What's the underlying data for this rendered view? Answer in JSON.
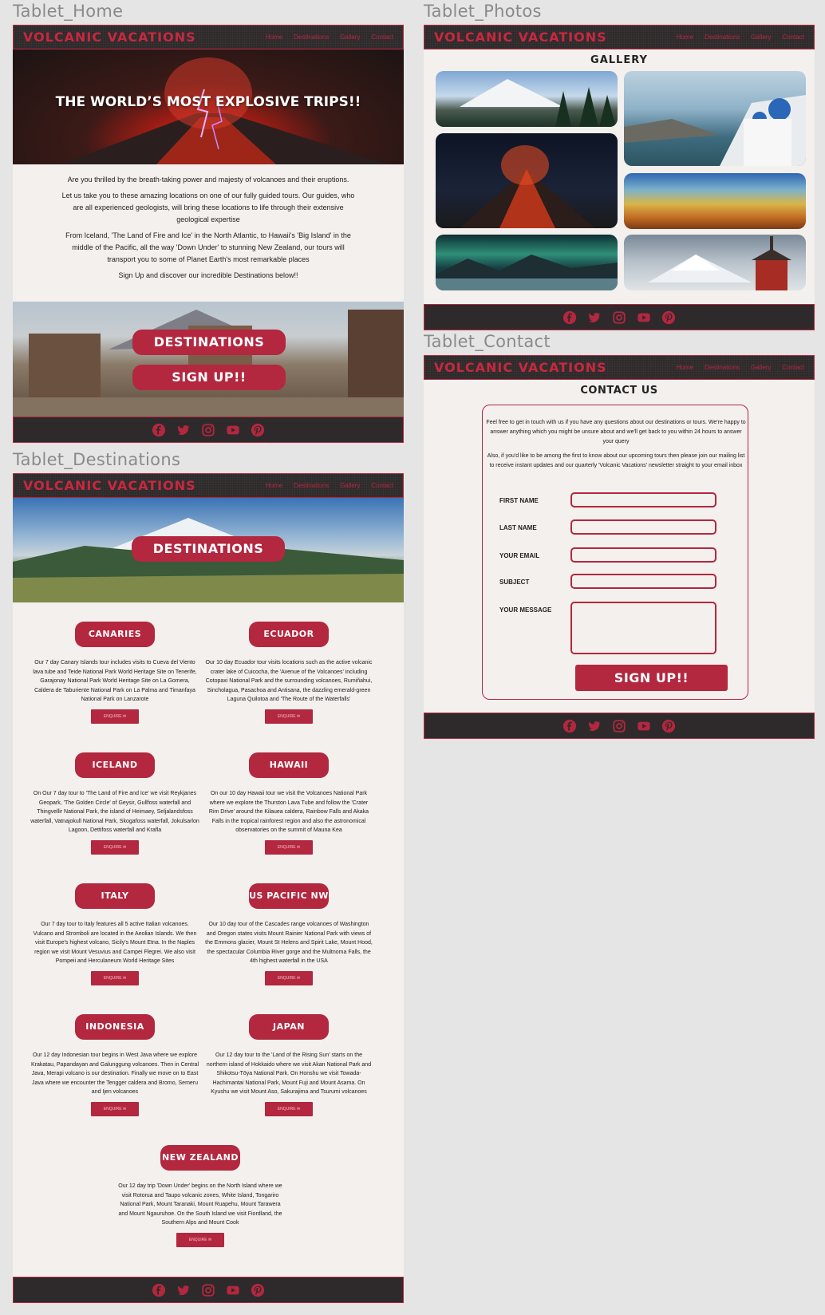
{
  "frames": {
    "home": "Tablet_Home",
    "photos": "Tablet_Photos",
    "contact": "Tablet_Contact",
    "destinations": "Tablet_Destinations"
  },
  "brand": "VOLCANIC VACATIONS",
  "nav": [
    "Home",
    "Destinations",
    "Gallery",
    "Contact"
  ],
  "social_icons": [
    "facebook-icon",
    "twitter-icon",
    "instagram-icon",
    "youtube-icon",
    "pinterest-icon"
  ],
  "colors": {
    "accent": "#b3273f",
    "dark": "#2e2a2b",
    "background": "#f3f0ee"
  },
  "home": {
    "hero_title": "THE WORLD’S MOST EXPLOSIVE TRIPS!!",
    "paragraphs": [
      "Are you thrilled by the breath-taking power and majesty of volcanoes and their eruptions.",
      "Let us take you to these amazing locations on one of our fully guided tours. Our guides, who are all experienced geologists, will bring these locations to life through their extensive geological expertise",
      "From Iceland, 'The Land of Fire and Ice' in the North Atlantic, to Hawaii's 'Big Island' in the middle of the Pacific, all the way 'Down Under'  to stunning New Zealand, our tours will transport you to some of Planet Earth's most remarkable places",
      "Sign Up and discover our incredible Destinations below!!"
    ],
    "destinations_button": "DESTINATIONS",
    "signup_button": "SIGN UP!!"
  },
  "photos": {
    "title": "GALLERY"
  },
  "contact": {
    "title": "CONTACT US",
    "intro1": "Feel free to get in touch with us if you have any questions about our destinations or tours. We're happy to answer anything which you might be unsure about and we'll get back to you within 24 hours to answer your query",
    "intro2": "Also, if you'd like to be among the first to know about our upcoming tours then please join our mailing list to receive instant updates and our quarterly 'Volcanic Vacations' newsletter straight to your email inbox",
    "labels": {
      "first": "FIRST NAME",
      "last": "LAST NAME",
      "email": "YOUR EMAIL",
      "subject": "SUBJECT",
      "message": "YOUR MESSAGE"
    },
    "submit": "SIGN UP!!"
  },
  "destinations": {
    "hero_button": "DESTINATIONS",
    "enquire": "ENQUIRE",
    "items": [
      {
        "name": "CANARIES",
        "text": "Our 7 day Canary Islands tour includes visits to Cueva del Viento lava tube and Teide National Park World Heritage Site on Tenerife, Garajonay National Park World Heritage Site on La Gomera, Caldera de Taburiente National Park on La Palma and Timanfaya National  Park on Lanzarote"
      },
      {
        "name": "ECUADOR",
        "text": "Our 10 day Ecuador tour visits locations such as the active volcanic crater lake of Cuicocha, the 'Avenue of the Volcanoes' including Cotopaxi National Park and the surrounding volcanoes, Rumiñahui, Sincholagua, Pasachoa and Antisana, the dazzling emerald-green Laguna Quilotoa and 'The Route of the Waterfalls'"
      },
      {
        "name": "ICELAND",
        "text": "On Our 7 day tour to 'The Land of Fire and Ice' we visit Reykjanes Geopark,  'The Golden Circle' of Geysir, Gullfoss waterfall and Thingvellir National Park, the island of Heimaey, Seljalandsfoss waterfall, Vatnajokull National Park, Skogafoss waterfall, Jokulsarlon Lagoon, Dettifoss waterfall and Krafla"
      },
      {
        "name": "HAWAII",
        "text": "On our 10 day Hawaii tour we visit the Volcanoes National Park where we explore the Thurston Lava Tube and follow the 'Crater Rim Drive' around the Kilauea caldera, Rainbow Falls and Akaka Falls in the tropical rainforest region and also the astronomical observatories on the summit of Mauna Kea"
      },
      {
        "name": "ITALY",
        "text": "Our 7 day tour to Italy features all 5 active Italian volcanoes. Vulcano and Stromboli are located in the Aeolian Islands. We then visit Europe's highest volcano, Sicily's Mount Etna. In the Naples region we visit Mount Vesuvius and Campei Flegrei. We also visit Pompeii and Herculaneum World Heritage Sites"
      },
      {
        "name": "US PACIFIC NW",
        "text": "Our 10 day tour of the Cascades range volcanoes of Washington and Oregon states visits Mount Rainier National Park with views of the Emmons glacier, Mount St Helens and Spirit Lake, Mount Hood, the spectacular Columbia River gorge and the Multnoma Falls, the 4th highest waterfall in the USA"
      },
      {
        "name": "INDONESIA",
        "text": "Our 12 day Indonesian tour begins in West Java where we explore Krakatau, Papandayan and Galunggung volcanoes. Then in Central Java, Merapi volcano is our destination. Finally we move on to East Java where we encounter the Tengger caldera and Bromo, Semeru and Ijen volcanoes"
      },
      {
        "name": "JAPAN",
        "text": "Our 12 day tour to the 'Land of the Rising Sun' starts on the northern island of Hokkaido where we visit Akan National Park and Shikotsu-Tōya National Park. On Honshu we visit Towada-Hachimantai National Park, Mount Fuji and Mount Asama. On Kyushu we visit Mount Aso, Sakurajima and Tsurumi  volcanoes"
      },
      {
        "name": "NEW ZEALAND",
        "text": "Our 12 day trip 'Down Under' begins on the North Island where we visit Rotorua and Taupo volcanic zones, White Island, Tongariro National Park, Mount Taranaki, Mount Ruapehu, Mount Tarawera and Mount Ngauruhoe. On the South Island we visit Fiordland, the Southern Alps and Mount Cook"
      }
    ]
  }
}
